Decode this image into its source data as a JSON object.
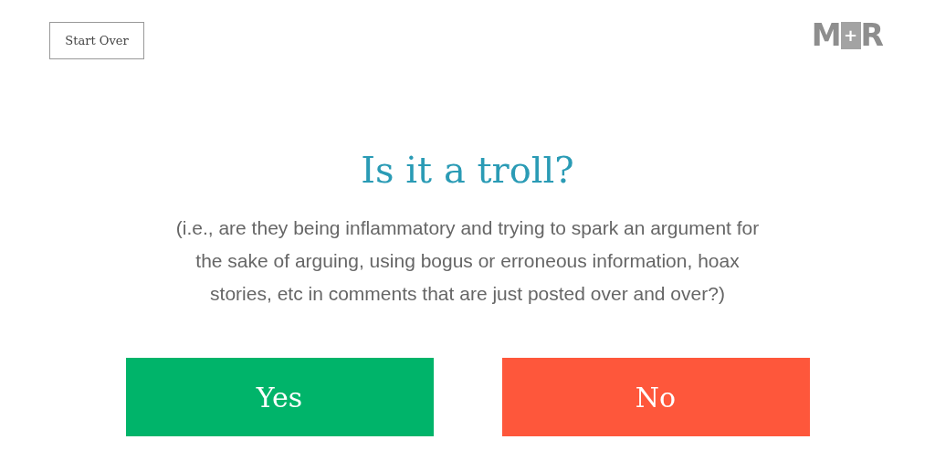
{
  "start_over": "Start Over",
  "logo": {
    "left": "M",
    "middle": "+",
    "right": "R"
  },
  "question": "Is it a troll?",
  "description": "(i.e., are they being inflammatory and trying to spark an argument for the sake of arguing, using bogus or erroneous information, hoax stories, etc in comments that are just posted over and over?)",
  "answers": [
    {
      "label": "Yes",
      "kind": "yes"
    },
    {
      "label": "No",
      "kind": "no"
    }
  ]
}
